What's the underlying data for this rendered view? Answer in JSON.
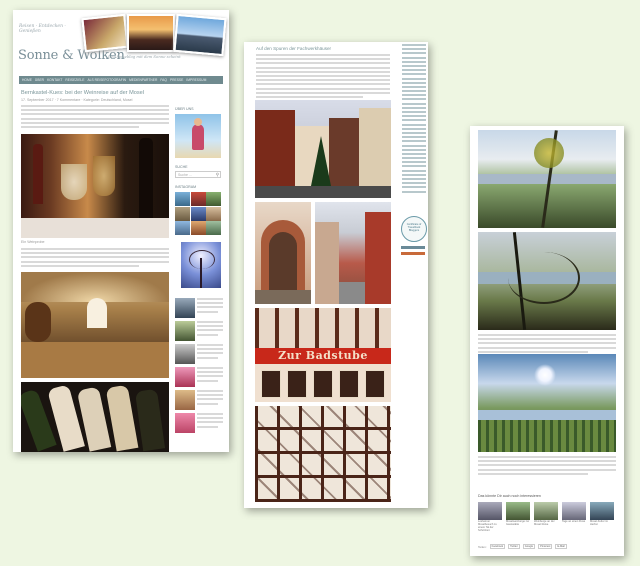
{
  "blog": {
    "title": "Sonne & Wolken",
    "script_header": "Reisen · Entdecken · Genießen",
    "tagline": "Der Reiseblog mit dem Sonne scheint",
    "menu": [
      "HOME",
      "ÜBER",
      "KONTAKT",
      "REISEZIELE",
      "ALS REISEFOTOGRAFIN",
      "MEDIENPARTNER",
      "FAQ",
      "PRESSE",
      "IMPRESSUM",
      "DATENSCHUTZ"
    ]
  },
  "left_post": {
    "title": "Bernkastel-Kues: bei der Weinreise auf der Mosel",
    "meta": "17. September 2017 · 7 Kommentare · Kategorie: Deutschland, Mosel",
    "caption": "Ein Weinprobe"
  },
  "sidebar_left": {
    "heading_about": "ÜBER UNS",
    "heading_search": "SUCHE",
    "heading_instagram": "INSTAGRAM",
    "search_placeholder": "Suche …"
  },
  "middle_post": {
    "title": "Auf den Spuren der Fachwerkhäuser",
    "sign_text": "Zur Badstube"
  },
  "middle_sidebar": {
    "badge_label": "Certificate of Travelbook Bloggers"
  },
  "right_post": {
    "related_heading": "Das könnte Dir auch noch interessieren",
    "related": [
      "Losheimer Moselbesuch zu einem Tal der Schönheit",
      "Moselweinberge zur Gastsstätte",
      "Weinberge an der Mosel Reise",
      "Tage an einen Fluss",
      "Mosel-Kultur im Herbst"
    ],
    "share_label": "Teilen:",
    "share_buttons": [
      "Facebook",
      "Twitter",
      "Google",
      "Pinterest",
      "E-Mail"
    ]
  },
  "colors": {
    "background": "#eef6e2",
    "menu_bar": "#6f8a8f",
    "post_title": "#7a9599"
  }
}
